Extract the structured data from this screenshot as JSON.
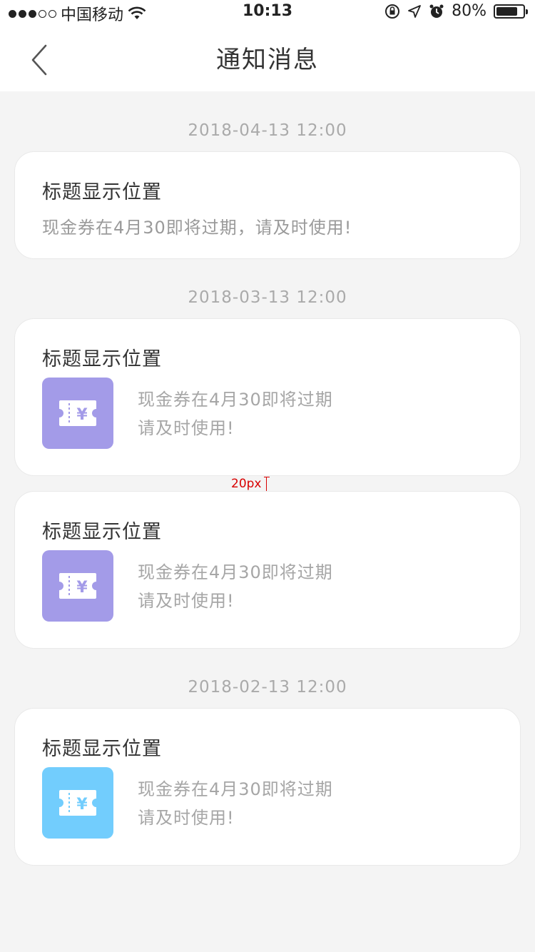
{
  "status_bar": {
    "carrier": "中国移动",
    "time": "10:13",
    "battery": "80%",
    "battery_level": 0.8,
    "icons": [
      "signal-dots-icon",
      "wifi-icon",
      "orientation-lock-icon",
      "location-arrow-icon",
      "alarm-icon",
      "battery-icon"
    ]
  },
  "nav": {
    "title": "通知消息",
    "back_icon": "chevron-left-icon"
  },
  "messages": [
    {
      "date": "2018-04-13 12:00",
      "title": "标题显示位置",
      "text": "现金券在4月30即将过期，请及时使用!",
      "has_coupon": false
    },
    {
      "date": "2018-03-13 12:00",
      "title": "标题显示位置",
      "desc_line1": "现金券在4月30即将过期",
      "desc_line2": "请及时使用!",
      "has_coupon": true,
      "icon_color": "#a39be8"
    },
    {
      "title": "标题显示位置",
      "desc_line1": "现金券在4月30即将过期",
      "desc_line2": "请及时使用!",
      "has_coupon": true,
      "icon_color": "#a39be8"
    },
    {
      "date": "2018-02-13 12:00",
      "title": "标题显示位置",
      "desc_line1": "现金券在4月30即将过期",
      "desc_line2": "请及时使用!",
      "has_coupon": true,
      "icon_color": "#72cdfd"
    }
  ],
  "annotation": {
    "label": "20px",
    "color": "#d80000"
  },
  "colors": {
    "background": "#f4f4f4",
    "card": "#ffffff",
    "title": "#333333",
    "muted": "#9a9a9a"
  }
}
